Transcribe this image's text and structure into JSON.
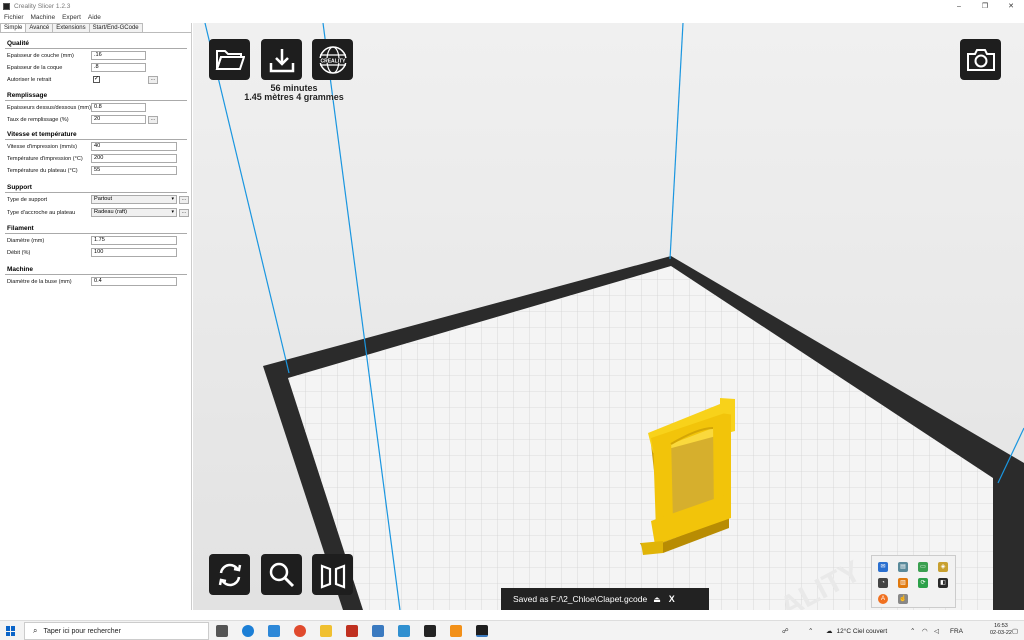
{
  "window": {
    "title": "Creality Slicer 1.2.3",
    "controls": {
      "minimize": "–",
      "maximize": "❐",
      "close": "✕"
    }
  },
  "menu": [
    "Fichier",
    "Machine",
    "Expert",
    "Aide"
  ],
  "tabs": [
    "Simple",
    "Avancé",
    "Extensions",
    "Start/End-GCode"
  ],
  "sections": {
    "qualite": {
      "title": "Qualité",
      "rows": [
        {
          "label": "Epaisseur de couche (mm)",
          "value": ".16"
        },
        {
          "label": "Epaisseur de la coque",
          "value": ".8"
        },
        {
          "label": "Autoriser le retrait",
          "checked": "✓",
          "btn": "..."
        }
      ]
    },
    "remplissage": {
      "title": "Remplissage",
      "rows": [
        {
          "label": "Epaisseurs dessus/dessous (mm)",
          "value": "0.8"
        },
        {
          "label": "Taux de remplissage (%)",
          "value": "20",
          "btn": "..."
        }
      ]
    },
    "vitesse": {
      "title": "Vitesse et température",
      "rows": [
        {
          "label": "Vitesse d'impression (mm/s)",
          "value": "40"
        },
        {
          "label": "Température d'impression (°C)",
          "value": "200"
        },
        {
          "label": "Température du plateau (°C)",
          "value": "55"
        }
      ]
    },
    "support": {
      "title": "Support",
      "rows": [
        {
          "label": "Type de support",
          "value": "Partout",
          "btn": "..."
        },
        {
          "label": "Type d'accroche au plateau",
          "value": "Radeau (raft)",
          "btn": "..."
        }
      ]
    },
    "filament": {
      "title": "Filament",
      "rows": [
        {
          "label": "Diamètre (mm)",
          "value": "1.75"
        },
        {
          "label": "Débit (%)",
          "value": "100"
        }
      ]
    },
    "machine": {
      "title": "Machine",
      "rows": [
        {
          "label": "Diamètre de la buse (mm)",
          "value": "0.4"
        }
      ]
    }
  },
  "viewport": {
    "print_time": "56 minutes",
    "print_material": "1.45 mètres 4 grammes",
    "toolbar_logo": "CREALITY",
    "bed_watermark": "ALITY",
    "saved_message": "Saved as F:/\\2_Chloe\\Clapet.gcode",
    "saved_eject": "⏏",
    "saved_close": "X",
    "colors": {
      "model": "#f2c40a",
      "bed": "#2b2b2b",
      "tool_bg": "#1e1e1e",
      "wire": "#1a96e0"
    }
  },
  "taskbar": {
    "search_placeholder": "Taper ici pour rechercher",
    "weather": "12°C  Ciel couvert",
    "language": "FRA",
    "time": "16:53",
    "date": "02-03-22"
  }
}
